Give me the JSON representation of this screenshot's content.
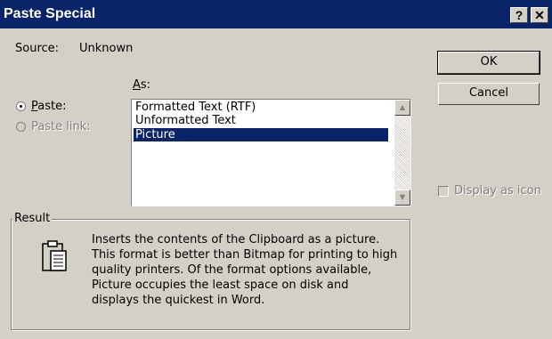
{
  "titlebar": {
    "title": "Paste Special",
    "help_button": "?",
    "close_button": "✕"
  },
  "source": {
    "label": "Source:",
    "value": "Unknown"
  },
  "as": {
    "label": "As:",
    "accel": "A",
    "rest": "s:"
  },
  "paste_options": {
    "paste": {
      "accel": "P",
      "rest": "aste:",
      "selected": true,
      "enabled": true
    },
    "paste_link": {
      "label": "Paste link:",
      "selected": false,
      "enabled": false
    }
  },
  "formats": {
    "items": [
      "Formatted Text (RTF)",
      "Unformatted Text",
      "Picture"
    ],
    "selected": "Picture"
  },
  "buttons": {
    "ok": "OK",
    "cancel": "Cancel"
  },
  "display_as_icon": {
    "label": "Display as icon",
    "checked": false,
    "enabled": false
  },
  "result": {
    "label": "Result",
    "icon": "clipboard-icon",
    "description": "Inserts the contents of the Clipboard as a picture. This format is better than Bitmap for printing to high quality printers. Of the format options available, Picture occupies the least space on disk and displays the quickest in Word."
  },
  "colors": {
    "titlebar": "#0a246a",
    "dialog_face": "#d4d0c8",
    "selection": "#0a246a",
    "disabled_text": "#808080"
  }
}
